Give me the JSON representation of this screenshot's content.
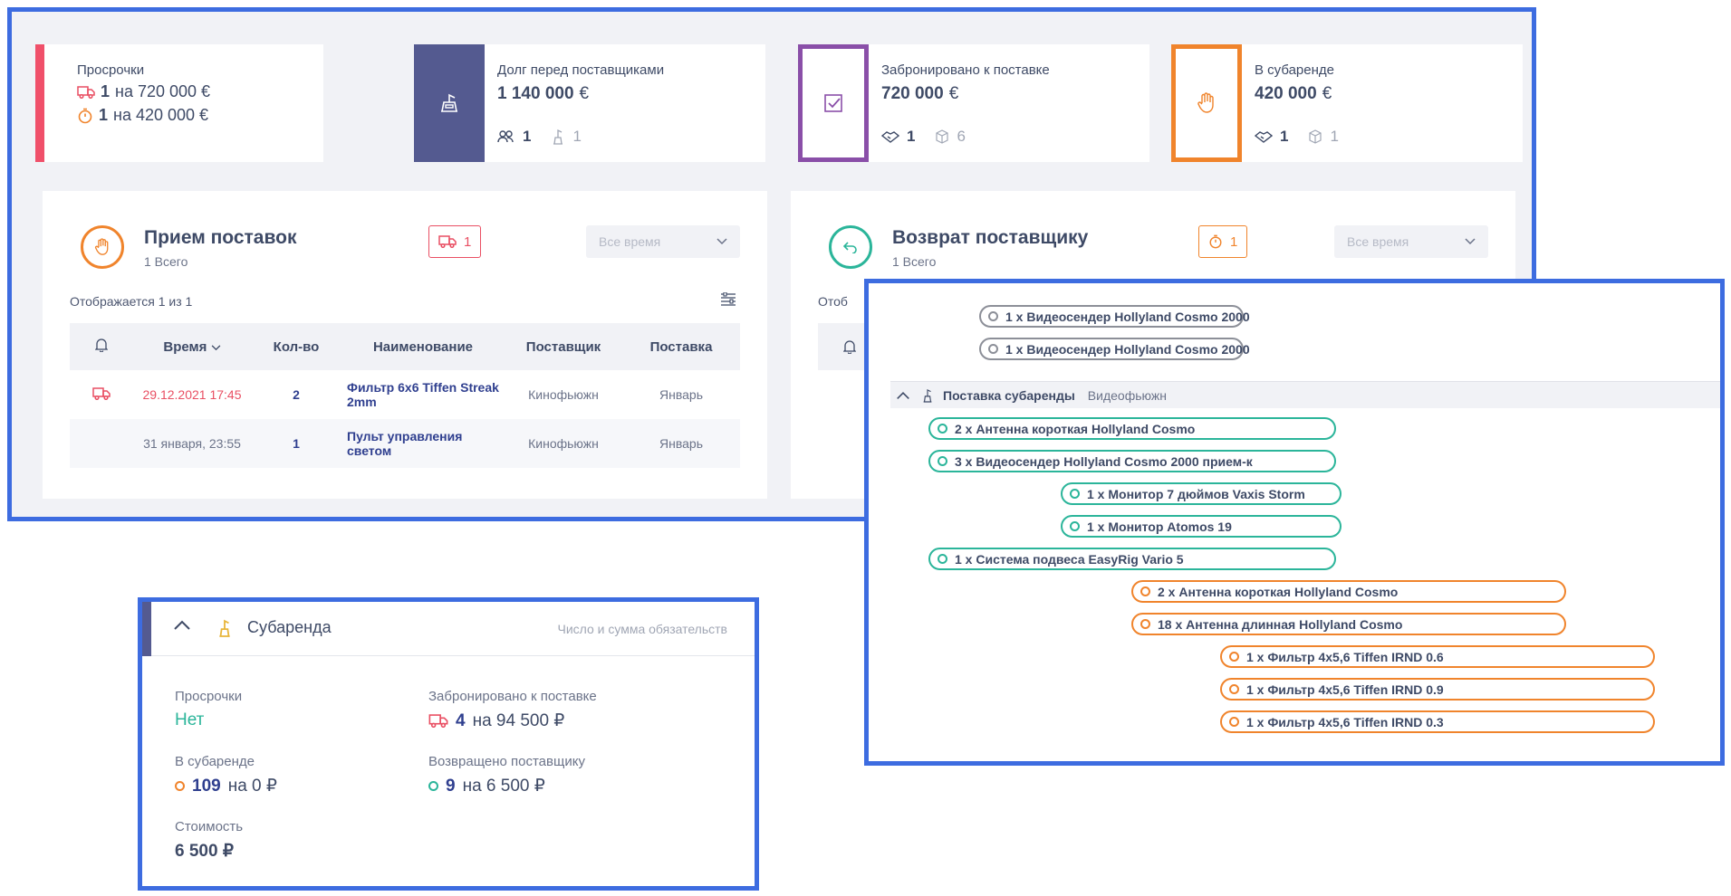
{
  "kpis": {
    "overdue": {
      "label": "Просрочки",
      "row1_count": "1",
      "row1_text": "на 720 000 €",
      "row2_count": "1",
      "row2_text": "на 420 000 €",
      "stripe_color": "#f0506a"
    },
    "debt": {
      "label": "Долг перед поставщиками",
      "amount": "1 140 000",
      "currency": "€",
      "people_count": "1",
      "sub_count": "1",
      "box_color": "#545a90"
    },
    "booked": {
      "label": "Забронировано к поставке",
      "amount": "720 000",
      "currency": "€",
      "deal_count": "1",
      "box_count": "6",
      "box_color": "#8a4fa8"
    },
    "subrent": {
      "label": "В субаренде",
      "amount": "420 000",
      "currency": "€",
      "deal_count": "1",
      "box_count": "1",
      "box_color": "#f0842c"
    }
  },
  "receipts": {
    "title": "Прием поставок",
    "subtitle": "1 Всего",
    "badge_count": "1",
    "select_value": "Все время",
    "showing": "Отображается 1 из 1",
    "columns": [
      "Время",
      "Кол-во",
      "Наименование",
      "Поставщик",
      "Поставка"
    ],
    "rows": [
      {
        "time": "29.12.2021 17:45",
        "qty": "2",
        "name": "Фильтр 6x6 Tiffen Streak 2mm",
        "supplier": "Кинофьюжн",
        "delivery": "Январь"
      },
      {
        "time": "31 января, 23:55",
        "qty": "1",
        "name": "Пульт управления светом",
        "supplier": "Кинофьюжн",
        "delivery": "Январь"
      }
    ]
  },
  "returns": {
    "title": "Возврат поставщику",
    "subtitle": "1 Всего",
    "badge_count": "1",
    "select_value": "Все время",
    "showing_partial": "Отоб"
  },
  "subrent_panel": {
    "title": "Субаренда",
    "note": "Число и сумма обязательств",
    "overdue_label": "Просрочки",
    "overdue_value": "Нет",
    "booked_label": "Забронировано к поставке",
    "booked_count": "4",
    "booked_text": "на 94 500 ₽",
    "insub_label": "В субаренде",
    "insub_count": "109",
    "insub_text": "на 0 ₽",
    "returned_label": "Возвращено поставщику",
    "returned_count": "9",
    "returned_text": "на 6 500 ₽",
    "cost_label": "Стоимость",
    "cost_value": "6 500 ₽"
  },
  "timeline": {
    "top_items": [
      "1 х Видеосендер Hollyland Cosmo 2000",
      "1 х Видеосендер Hollyland Cosmo 2000"
    ],
    "group_title": "Поставка субаренды",
    "group_supplier": "Видеофьюжн",
    "items": [
      "2 х Антенна короткая Hollyland Cosmo",
      "3 х Видеосендер Hollyland Cosmo 2000 прием-к",
      "1 х Монитор 7 дюймов Vaxis Storm",
      "1 х Монитор Atomos 19",
      "1 х Система подвеса EasyRig Vario 5",
      "2 х Антенна короткая Hollyland Cosmo",
      "18 х Антенна длинная Hollyland Cosmo",
      "1 х Фильтр 4x5,6 Tiffen IRND 0.6",
      "1 х Фильтр 4x5,6 Tiffen IRND 0.9",
      "1 х Фильтр 4x5,6 Tiffen IRND 0.3"
    ]
  }
}
